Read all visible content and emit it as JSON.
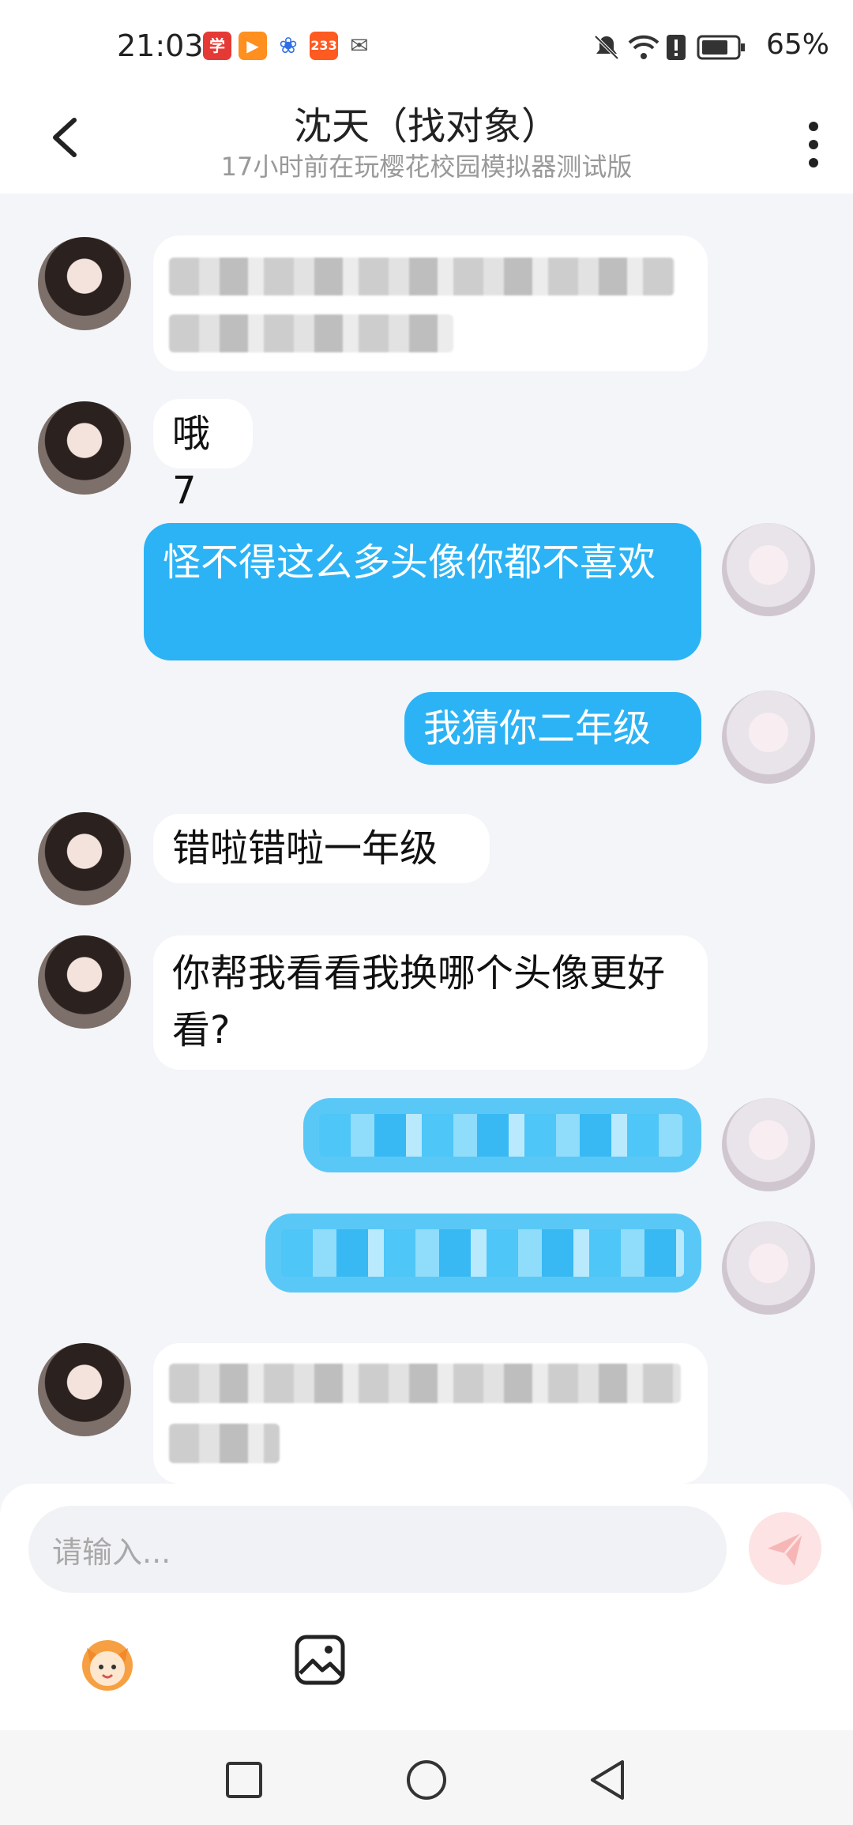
{
  "status_bar": {
    "time": "21:03",
    "battery": "65%",
    "app_icons": [
      {
        "name": "xuexi-app-icon",
        "glyph": "学",
        "color": "#e53935"
      },
      {
        "name": "video-app-icon",
        "glyph": "▶",
        "color": "#ff8f1f"
      },
      {
        "name": "baidu-app-icon",
        "glyph": "🐾",
        "color": "#2f6ee5"
      },
      {
        "name": "233-app-icon",
        "glyph": "233",
        "color": "#ff5a1f"
      },
      {
        "name": "wechat-app-icon",
        "glyph": "💬",
        "color": "#555555"
      }
    ]
  },
  "header": {
    "title": "沈天（找对象）",
    "subtitle": "17小时前在玩樱花校园模拟器测试版"
  },
  "messages": [
    {
      "side": "in",
      "text": "",
      "blurred": true
    },
    {
      "side": "in",
      "text": "哦7"
    },
    {
      "side": "out",
      "text": "怪不得这么多头像你都不喜欢"
    },
    {
      "side": "out",
      "text": "我猜你二年级"
    },
    {
      "side": "in",
      "text": "错啦错啦一年级"
    },
    {
      "side": "in",
      "text": "你帮我看看我换哪个头像更好看?"
    },
    {
      "side": "out",
      "text": "",
      "blurred": true
    },
    {
      "side": "out",
      "text": "",
      "blurred": true
    },
    {
      "side": "in",
      "text": "",
      "blurred": true
    }
  ],
  "input": {
    "placeholder": "请输入..."
  },
  "colors": {
    "accent": "#2cb3f5",
    "background": "#f3f5f8",
    "send_button": "#fde3e3"
  }
}
